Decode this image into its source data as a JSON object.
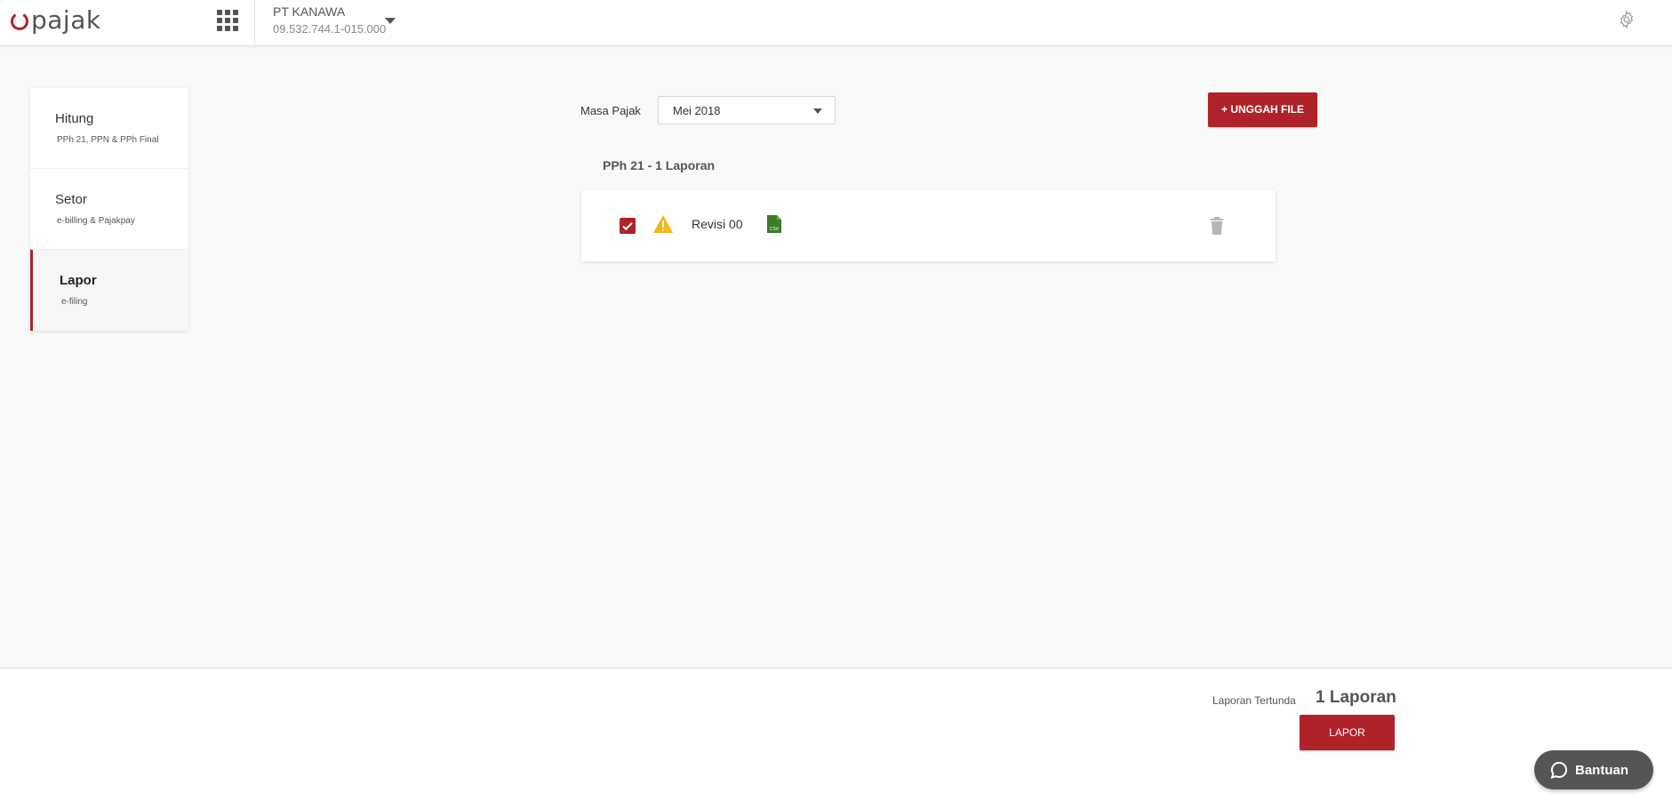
{
  "header": {
    "logo_text": "pajak",
    "company_name": "PT KANAWA",
    "company_npwp": "09.532.744.1-015.000"
  },
  "sidebar": {
    "items": [
      {
        "title": "Hitung",
        "subtitle": "PPh 21, PPN & PPh Final",
        "active": false
      },
      {
        "title": "Setor",
        "subtitle": "e-billing & Pajakpay",
        "active": false
      },
      {
        "title": "Lapor",
        "subtitle": "e-filing",
        "active": true
      }
    ]
  },
  "filter": {
    "label": "Masa Pajak",
    "selected": "Mei 2018"
  },
  "upload_button": "+ UNGGAH FILE",
  "group": {
    "title": "PPh 21 - 1 Laporan",
    "items": [
      {
        "label": "Revisi 00",
        "checked": true,
        "file_type": "CSV"
      }
    ]
  },
  "footer": {
    "pending_label": "Laporan Tertunda",
    "pending_count": "1 Laporan",
    "submit_button": "LAPOR"
  },
  "help_button": "Bantuan",
  "colors": {
    "accent": "#b0222a",
    "warning": "#f2b81b",
    "csv": "#3d7a2a"
  }
}
